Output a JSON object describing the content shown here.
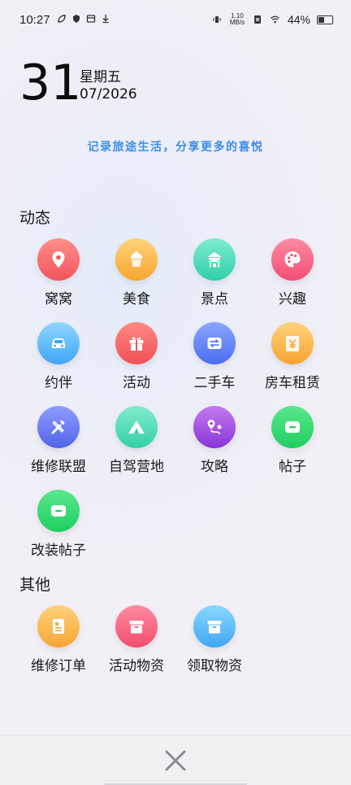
{
  "status_bar": {
    "time": "10:27",
    "net_speed_value": "1.10",
    "net_speed_unit": "MB/s",
    "battery_percent": "44%",
    "battery_level": 0.44
  },
  "header": {
    "day": "31",
    "weekday": "星期五",
    "month_year": "07/2026",
    "slogan": "记录旅途生活，分享更多的喜悦"
  },
  "sections": {
    "dynamic_title": "动态",
    "other_title": "其他"
  },
  "dynamic_items": [
    {
      "label": "窝窝",
      "icon": "location-pin-icon",
      "color_from": "#ff8f8a",
      "color_to": "#f2545b"
    },
    {
      "label": "美食",
      "icon": "cupcake-icon",
      "color_from": "#ffd37a",
      "color_to": "#f7a630"
    },
    {
      "label": "景点",
      "icon": "pavilion-icon",
      "color_from": "#7fecd0",
      "color_to": "#2fcfa8"
    },
    {
      "label": "兴趣",
      "icon": "palette-icon",
      "color_from": "#ff8ba3",
      "color_to": "#f24d73"
    },
    {
      "label": "约伴",
      "icon": "car-icon",
      "color_from": "#8fd6ff",
      "color_to": "#3fa7f5"
    },
    {
      "label": "活动",
      "icon": "gift-icon",
      "color_from": "#ff8a85",
      "color_to": "#f24f55"
    },
    {
      "label": "二手车",
      "icon": "swap-car-icon",
      "color_from": "#8aa6ff",
      "color_to": "#4a6cf0"
    },
    {
      "label": "房车租赁",
      "icon": "yen-card-icon",
      "color_from": "#ffd27a",
      "color_to": "#f7a531"
    },
    {
      "label": "维修联盟",
      "icon": "tools-icon",
      "color_from": "#8f9dff",
      "color_to": "#5363ea"
    },
    {
      "label": "自驾营地",
      "icon": "tent-icon",
      "color_from": "#82ebcd",
      "color_to": "#34d0a4"
    },
    {
      "label": "攻略",
      "icon": "route-map-icon",
      "color_from": "#c27bf0",
      "color_to": "#8a35d6"
    },
    {
      "label": "帖子",
      "icon": "chat-bubble-icon",
      "color_from": "#59e88c",
      "color_to": "#1fce62"
    },
    {
      "label": "改装帖子",
      "icon": "chat-bubble-icon",
      "color_from": "#59e88c",
      "color_to": "#1fce62"
    }
  ],
  "other_items": [
    {
      "label": "维修订单",
      "icon": "order-list-icon",
      "color_from": "#ffd27a",
      "color_to": "#f7a531"
    },
    {
      "label": "活动物资",
      "icon": "box-icon",
      "color_from": "#ff8aa0",
      "color_to": "#f24d6e"
    },
    {
      "label": "领取物资",
      "icon": "box-icon",
      "color_from": "#8ad8ff",
      "color_to": "#3fa7f5"
    }
  ],
  "bottom": {
    "close_icon": "close-icon"
  }
}
